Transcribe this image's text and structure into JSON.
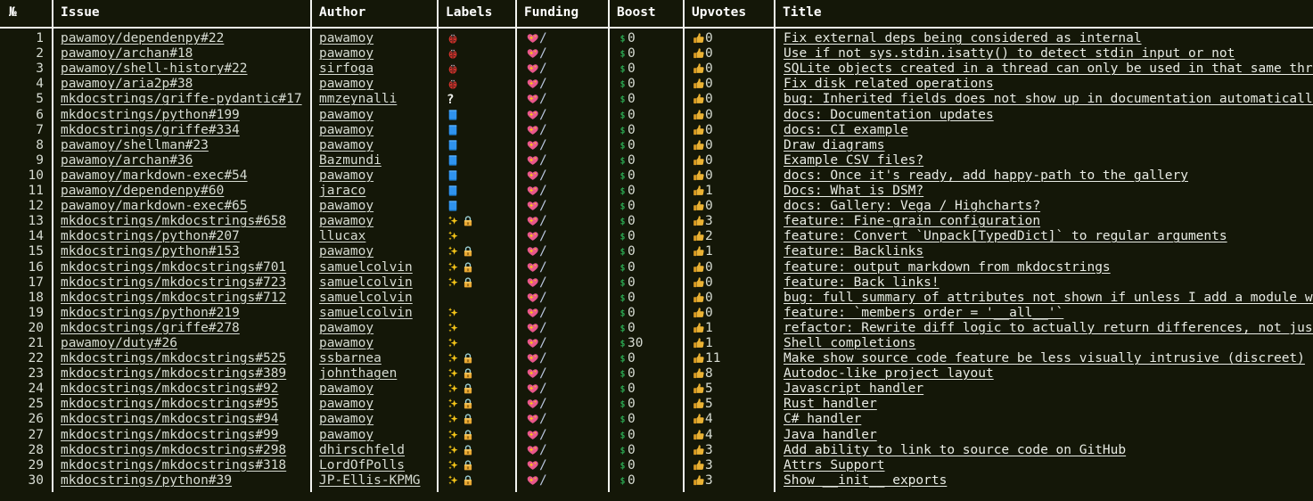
{
  "theme": {
    "background": "#141708",
    "text": "#d6dbd2",
    "border": "#f2f3ef",
    "money_green": "#2aa44f",
    "lock_yellow": "#e8a33d",
    "sparkle_yellow": "#f5c518",
    "heart_pink": "#e8507f",
    "book_blue": "#2f8fe0",
    "bug_red": "#d1322a",
    "thumb_yellow": "#eab234"
  },
  "table": {
    "columns": [
      {
        "key": "num",
        "label": "№"
      },
      {
        "key": "issue",
        "label": "Issue"
      },
      {
        "key": "author",
        "label": "Author"
      },
      {
        "key": "labels",
        "label": "Labels"
      },
      {
        "key": "funding",
        "label": "Funding"
      },
      {
        "key": "boost",
        "label": "Boost"
      },
      {
        "key": "upvotes",
        "label": "Upvotes"
      },
      {
        "key": "title",
        "label": "Title"
      }
    ],
    "rows": [
      {
        "num": "1",
        "issue": "pawamoy/dependenpy#22",
        "author": "pawamoy",
        "labels": [
          "bug-icon"
        ],
        "funding": "/",
        "boost": "0",
        "upvotes": "0",
        "title": "Fix external deps being considered as internal"
      },
      {
        "num": "2",
        "issue": "pawamoy/archan#18",
        "author": "pawamoy",
        "labels": [
          "bug-icon"
        ],
        "funding": "/",
        "boost": "0",
        "upvotes": "0",
        "title": "Use if not sys.stdin.isatty() to detect stdin input or not"
      },
      {
        "num": "3",
        "issue": "pawamoy/shell-history#22",
        "author": "sirfoga",
        "labels": [
          "bug-icon"
        ],
        "funding": "/",
        "boost": "0",
        "upvotes": "0",
        "title": "SQLite objects created in a thread can only be used in that same thread"
      },
      {
        "num": "4",
        "issue": "pawamoy/aria2p#38",
        "author": "pawamoy",
        "labels": [
          "bug-icon"
        ],
        "funding": "/",
        "boost": "0",
        "upvotes": "0",
        "title": "Fix disk related operations"
      },
      {
        "num": "5",
        "issue": "mkdocstrings/griffe-pydantic#17",
        "author": "mmzeynalli",
        "labels": [
          "question-icon"
        ],
        "funding": "/",
        "boost": "0",
        "upvotes": "0",
        "title": "bug: Inherited fields does not show up in documentation automatically (in fields section)"
      },
      {
        "num": "6",
        "issue": "mkdocstrings/python#199",
        "author": "pawamoy",
        "labels": [
          "book-icon"
        ],
        "funding": "/",
        "boost": "0",
        "upvotes": "0",
        "title": "docs: Documentation updates"
      },
      {
        "num": "7",
        "issue": "mkdocstrings/griffe#334",
        "author": "pawamoy",
        "labels": [
          "book-icon"
        ],
        "funding": "/",
        "boost": "0",
        "upvotes": "0",
        "title": "docs: CI example"
      },
      {
        "num": "8",
        "issue": "pawamoy/shellman#23",
        "author": "pawamoy",
        "labels": [
          "book-icon"
        ],
        "funding": "/",
        "boost": "0",
        "upvotes": "0",
        "title": "Draw diagrams"
      },
      {
        "num": "9",
        "issue": "pawamoy/archan#36",
        "author": "Bazmundi",
        "labels": [
          "book-icon"
        ],
        "funding": "/",
        "boost": "0",
        "upvotes": "0",
        "title": "Example CSV files?"
      },
      {
        "num": "10",
        "issue": "pawamoy/markdown-exec#54",
        "author": "pawamoy",
        "labels": [
          "book-icon"
        ],
        "funding": "/",
        "boost": "0",
        "upvotes": "0",
        "title": "docs: Once it's ready, add happy-path to the gallery"
      },
      {
        "num": "11",
        "issue": "pawamoy/dependenpy#60",
        "author": "jaraco",
        "labels": [
          "book-icon"
        ],
        "funding": "/",
        "boost": "0",
        "upvotes": "1",
        "title": "Docs: What is DSM?"
      },
      {
        "num": "12",
        "issue": "pawamoy/markdown-exec#65",
        "author": "pawamoy",
        "labels": [
          "book-icon"
        ],
        "funding": "/",
        "boost": "0",
        "upvotes": "0",
        "title": "docs: Gallery: Vega / Highcharts?"
      },
      {
        "num": "13",
        "issue": "mkdocstrings/mkdocstrings#658",
        "author": "pawamoy",
        "labels": [
          "sparkles-icon",
          "lock-icon"
        ],
        "funding": "/",
        "boost": "0",
        "upvotes": "3",
        "title": "feature: Fine-grain configuration"
      },
      {
        "num": "14",
        "issue": "mkdocstrings/python#207",
        "author": "llucax",
        "labels": [
          "sparkles-icon"
        ],
        "funding": "/",
        "boost": "0",
        "upvotes": "2",
        "title": "feature: Convert `Unpack[TypedDict]` to regular arguments"
      },
      {
        "num": "15",
        "issue": "mkdocstrings/python#153",
        "author": "pawamoy",
        "labels": [
          "sparkles-icon",
          "lock-icon"
        ],
        "funding": "/",
        "boost": "0",
        "upvotes": "1",
        "title": "feature: Backlinks"
      },
      {
        "num": "16",
        "issue": "mkdocstrings/mkdocstrings#701",
        "author": "samuelcolvin",
        "labels": [
          "sparkles-icon",
          "lock-icon"
        ],
        "funding": "/",
        "boost": "0",
        "upvotes": "0",
        "title": "feature: output markdown from mkdocstrings"
      },
      {
        "num": "17",
        "issue": "mkdocstrings/mkdocstrings#723",
        "author": "samuelcolvin",
        "labels": [
          "sparkles-icon",
          "lock-icon"
        ],
        "funding": "/",
        "boost": "0",
        "upvotes": "0",
        "title": "feature: Back links!"
      },
      {
        "num": "18",
        "issue": "mkdocstrings/mkdocstrings#712",
        "author": "samuelcolvin",
        "labels": [],
        "funding": "/",
        "boost": "0",
        "upvotes": "0",
        "title": "bug: full summary of attributes not shown if unless I add a module with members"
      },
      {
        "num": "19",
        "issue": "mkdocstrings/python#219",
        "author": "samuelcolvin",
        "labels": [
          "sparkles-icon"
        ],
        "funding": "/",
        "boost": "0",
        "upvotes": "0",
        "title": "feature: `members order = '__all__'`"
      },
      {
        "num": "20",
        "issue": "mkdocstrings/griffe#278",
        "author": "pawamoy",
        "labels": [
          "sparkles-icon"
        ],
        "funding": "/",
        "boost": "0",
        "upvotes": "1",
        "title": "refactor: Rewrite diff logic to actually return differences, not just breaking changes"
      },
      {
        "num": "21",
        "issue": "pawamoy/duty#26",
        "author": "pawamoy",
        "labels": [
          "sparkles-icon"
        ],
        "funding": "/",
        "boost": "30",
        "upvotes": "1",
        "title": "Shell completions"
      },
      {
        "num": "22",
        "issue": "mkdocstrings/mkdocstrings#525",
        "author": "ssbarnea",
        "labels": [
          "sparkles-icon",
          "lock-icon"
        ],
        "funding": "/",
        "boost": "0",
        "upvotes": "11",
        "title": "Make show source code feature be less visually intrusive (discreet)"
      },
      {
        "num": "23",
        "issue": "mkdocstrings/mkdocstrings#389",
        "author": "johnthagen",
        "labels": [
          "sparkles-icon",
          "lock-icon"
        ],
        "funding": "/",
        "boost": "0",
        "upvotes": "8",
        "title": "Autodoc-like project layout"
      },
      {
        "num": "24",
        "issue": "mkdocstrings/mkdocstrings#92",
        "author": "pawamoy",
        "labels": [
          "sparkles-icon",
          "lock-icon"
        ],
        "funding": "/",
        "boost": "0",
        "upvotes": "5",
        "title": "Javascript handler"
      },
      {
        "num": "25",
        "issue": "mkdocstrings/mkdocstrings#95",
        "author": "pawamoy",
        "labels": [
          "sparkles-icon",
          "lock-icon"
        ],
        "funding": "/",
        "boost": "0",
        "upvotes": "5",
        "title": "Rust handler"
      },
      {
        "num": "26",
        "issue": "mkdocstrings/mkdocstrings#94",
        "author": "pawamoy",
        "labels": [
          "sparkles-icon",
          "lock-icon"
        ],
        "funding": "/",
        "boost": "0",
        "upvotes": "4",
        "title": "C# handler"
      },
      {
        "num": "27",
        "issue": "mkdocstrings/mkdocstrings#99",
        "author": "pawamoy",
        "labels": [
          "sparkles-icon",
          "lock-icon"
        ],
        "funding": "/",
        "boost": "0",
        "upvotes": "4",
        "title": "Java handler"
      },
      {
        "num": "28",
        "issue": "mkdocstrings/mkdocstrings#298",
        "author": "dhirschfeld",
        "labels": [
          "sparkles-icon",
          "lock-icon"
        ],
        "funding": "/",
        "boost": "0",
        "upvotes": "3",
        "title": "Add ability to link to source code on GitHub"
      },
      {
        "num": "29",
        "issue": "mkdocstrings/mkdocstrings#318",
        "author": "LordOfPolls",
        "labels": [
          "sparkles-icon",
          "lock-icon"
        ],
        "funding": "/",
        "boost": "0",
        "upvotes": "3",
        "title": "Attrs Support"
      },
      {
        "num": "30",
        "issue": "mkdocstrings/python#39",
        "author": "JP-Ellis-KPMG",
        "labels": [
          "sparkles-icon",
          "lock-icon"
        ],
        "funding": "/",
        "boost": "0",
        "upvotes": "3",
        "title": "Show __init__ exports"
      }
    ]
  },
  "icons": {
    "funding_prefix": "sparkling-heart-icon",
    "boost_prefix": "dollar-icon",
    "upvotes_prefix": "thumbs-up-icon"
  }
}
